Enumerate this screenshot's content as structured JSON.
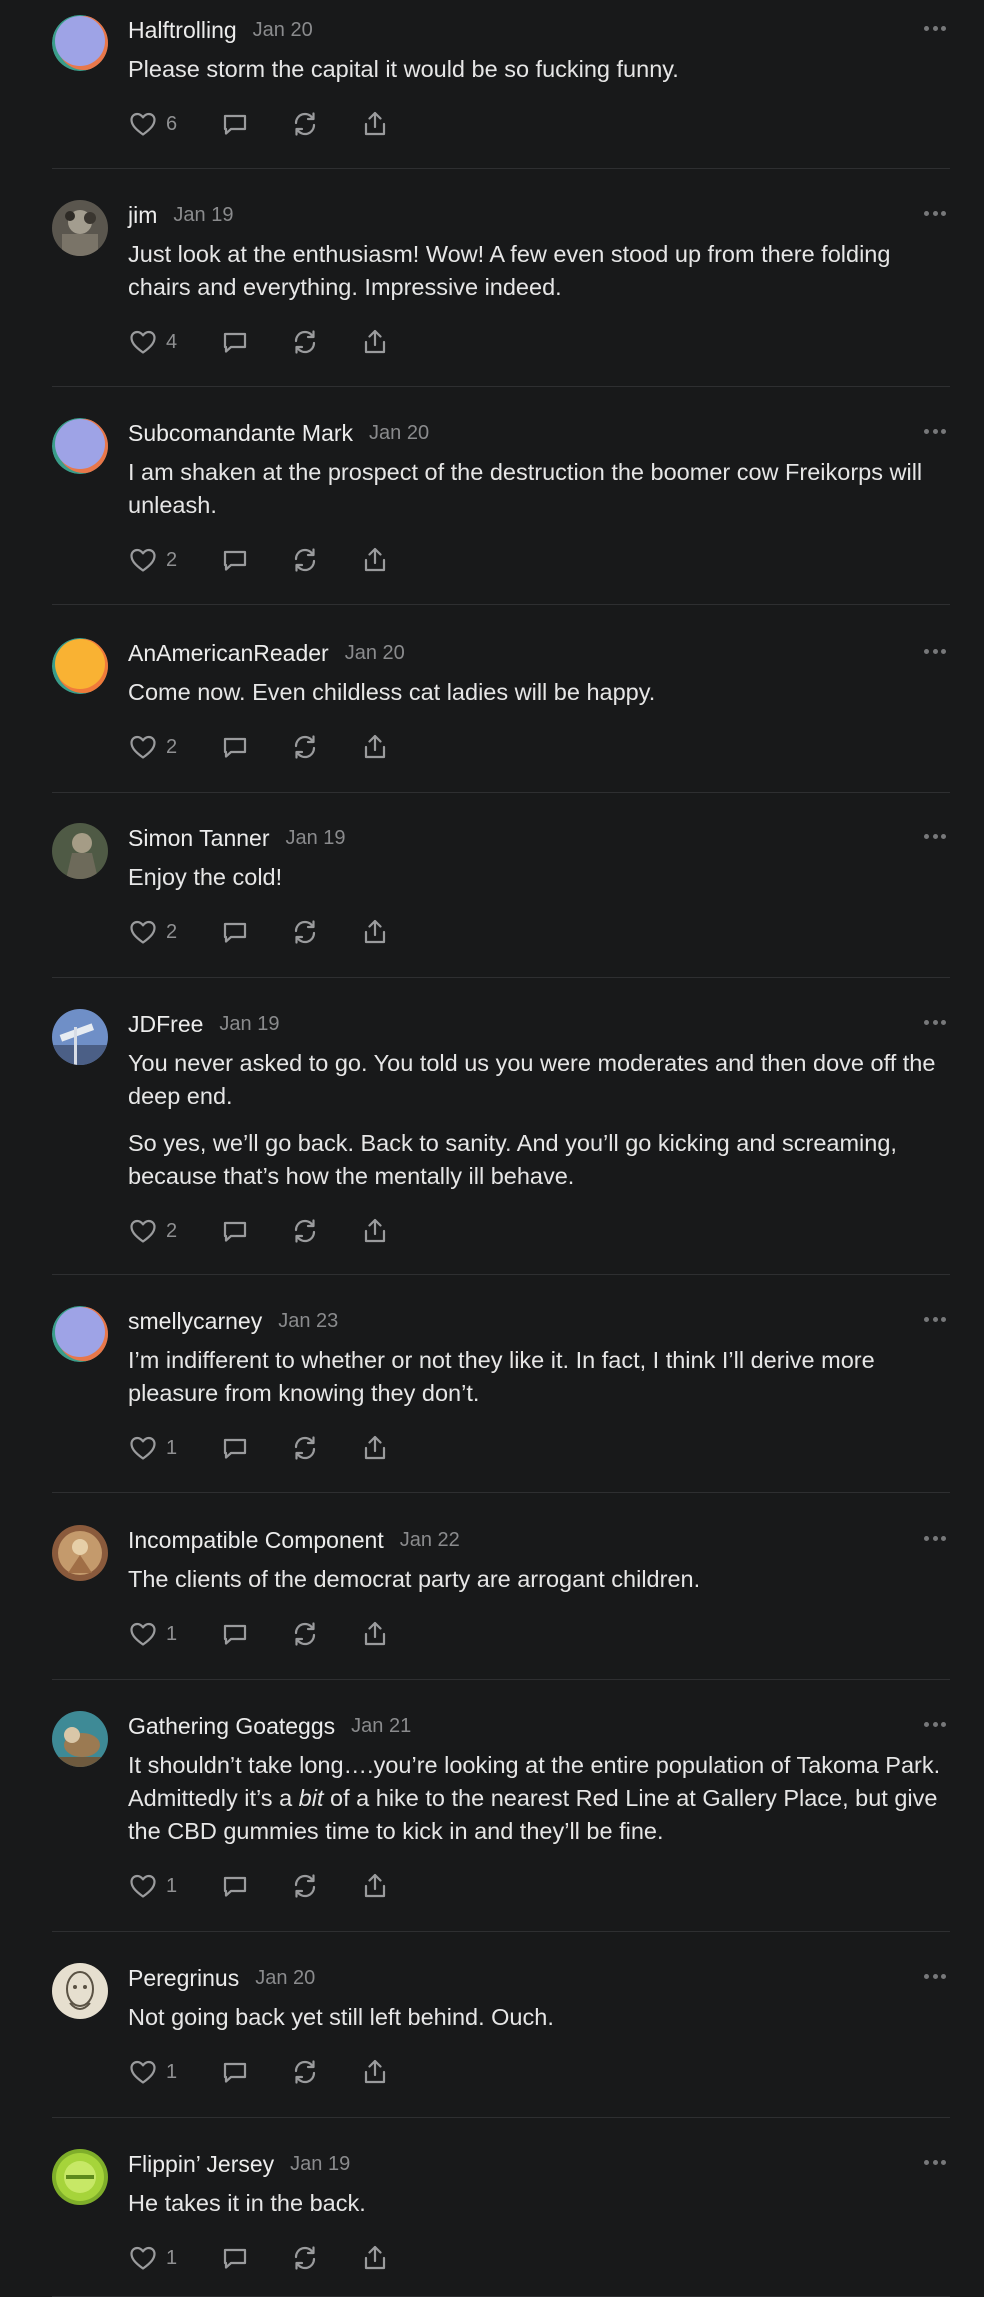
{
  "colors": {
    "background": "#18191a",
    "text": "#e6e6e6",
    "muted": "#8a8b8d",
    "divider": "#2e2f31",
    "icon": "#9a9b9d"
  },
  "icons": {
    "like": "heart-icon",
    "reply": "comment-icon",
    "restack": "restack-icon",
    "share": "share-icon",
    "more": "ellipsis-icon"
  },
  "comments": [
    {
      "author": "Halftrolling",
      "date": "Jan 20",
      "paragraphs": [
        "Please storm the capital it would be so fucking funny."
      ],
      "likes": "6",
      "avatar": "gradient-purple"
    },
    {
      "author": "jim",
      "date": "Jan 19",
      "paragraphs": [
        "Just look at the enthusiasm! Wow! A few even stood up from there folding chairs and everything. Impressive indeed."
      ],
      "likes": "4",
      "avatar": "photo-gray"
    },
    {
      "author": "Subcomandante Mark",
      "date": "Jan 20",
      "paragraphs": [
        "I am shaken at the prospect of the destruction the boomer cow Freikorps will unleash."
      ],
      "likes": "2",
      "avatar": "gradient-purple"
    },
    {
      "author": "AnAmericanReader",
      "date": "Jan 20",
      "paragraphs": [
        "Come now. Even childless cat ladies will be happy."
      ],
      "likes": "2",
      "avatar": "gradient-orange"
    },
    {
      "author": "Simon Tanner",
      "date": "Jan 19",
      "paragraphs": [
        "Enjoy the cold!"
      ],
      "likes": "2",
      "avatar": "photo-green"
    },
    {
      "author": "JDFree",
      "date": "Jan 19",
      "paragraphs": [
        "You never asked to go. You told us you were moderates and then dove off the deep end.",
        "So yes, we’ll go back. Back to sanity. And you’ll go kicking and screaming, because that’s how the mentally ill behave."
      ],
      "likes": "2",
      "avatar": "photo-blue"
    },
    {
      "author": "smellycarney",
      "date": "Jan 23",
      "paragraphs": [
        "I’m indifferent to whether or not they like it. In fact, I think I’ll derive more pleasure from knowing they don’t."
      ],
      "likes": "1",
      "avatar": "gradient-purple"
    },
    {
      "author": "Incompatible Component",
      "date": "Jan 22",
      "paragraphs": [
        "The clients of the democrat party are arrogant children."
      ],
      "likes": "1",
      "avatar": "photo-brown"
    },
    {
      "author": "Gathering Goateggs",
      "date": "Jan 21",
      "paragraphs": [
        [
          "It shouldn’t take long….you’re looking at the entire population of Takoma Park. Admittedly it’s a ",
          "bit",
          " of a hike to the nearest Red Line at Gallery Place, but give the CBD gummies time to kick in and they’ll be fine."
        ]
      ],
      "likes": "1",
      "avatar": "photo-teal"
    },
    {
      "author": "Peregrinus",
      "date": "Jan 20",
      "paragraphs": [
        "Not going back yet still left behind. Ouch."
      ],
      "likes": "1",
      "avatar": "photo-sketch"
    },
    {
      "author": "Flippin’ Jersey",
      "date": "Jan 19",
      "paragraphs": [
        "He takes it in the back."
      ],
      "likes": "1",
      "avatar": "photo-lime"
    }
  ]
}
